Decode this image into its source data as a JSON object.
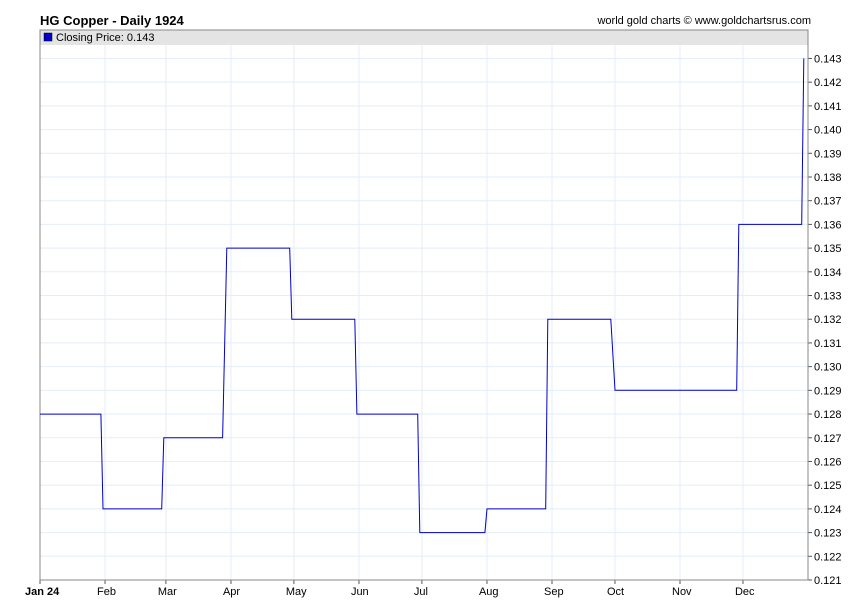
{
  "chart_data": {
    "type": "line",
    "title": "HG Copper - Daily 1924",
    "credit": "world gold charts © www.goldchartsrus.com",
    "legend": {
      "label": "Closing Price: 0.143",
      "color": "#0000cc",
      "placement": "top-left"
    },
    "xlabel": "",
    "ylabel": "",
    "ylim": [
      0.121,
      0.1442
    ],
    "xrange": [
      "1924-01-01",
      "1924-12-31"
    ],
    "yticks": [
      0.121,
      0.122,
      0.123,
      0.124,
      0.125,
      0.126,
      0.127,
      0.128,
      0.129,
      0.13,
      0.131,
      0.132,
      0.133,
      0.134,
      0.135,
      0.136,
      0.137,
      0.138,
      0.139,
      0.14,
      0.141,
      0.142,
      0.143
    ],
    "xticks": [
      {
        "date": "1924-01-01",
        "label": "Jan 24"
      },
      {
        "date": "1924-02-01",
        "label": "Feb"
      },
      {
        "date": "1924-03-01",
        "label": "Mar"
      },
      {
        "date": "1924-04-01",
        "label": "Apr"
      },
      {
        "date": "1924-05-01",
        "label": "May"
      },
      {
        "date": "1924-06-01",
        "label": "Jun"
      },
      {
        "date": "1924-07-01",
        "label": "Jul"
      },
      {
        "date": "1924-08-01",
        "label": "Aug"
      },
      {
        "date": "1924-09-01",
        "label": "Sep"
      },
      {
        "date": "1924-10-01",
        "label": "Oct"
      },
      {
        "date": "1924-11-01",
        "label": "Nov"
      },
      {
        "date": "1924-12-01",
        "label": "Dec"
      }
    ],
    "series": [
      {
        "name": "Closing Price",
        "color": "#0000cc",
        "points": [
          [
            "1924-01-01",
            0.128
          ],
          [
            "1924-01-30",
            0.128
          ],
          [
            "1924-01-31",
            0.124
          ],
          [
            "1924-02-28",
            0.124
          ],
          [
            "1924-02-29",
            0.127
          ],
          [
            "1924-03-28",
            0.127
          ],
          [
            "1924-03-30",
            0.135
          ],
          [
            "1924-04-29",
            0.135
          ],
          [
            "1924-04-30",
            0.132
          ],
          [
            "1924-05-30",
            0.132
          ],
          [
            "1924-05-31",
            0.128
          ],
          [
            "1924-06-29",
            0.128
          ],
          [
            "1924-06-30",
            0.123
          ],
          [
            "1924-07-31",
            0.123
          ],
          [
            "1924-08-01",
            0.124
          ],
          [
            "1924-08-29",
            0.124
          ],
          [
            "1924-08-30",
            0.132
          ],
          [
            "1924-09-29",
            0.132
          ],
          [
            "1924-10-01",
            0.129
          ],
          [
            "1924-11-28",
            0.129
          ],
          [
            "1924-11-29",
            0.136
          ],
          [
            "1924-12-29",
            0.136
          ],
          [
            "1924-12-30",
            0.143
          ]
        ]
      }
    ]
  }
}
